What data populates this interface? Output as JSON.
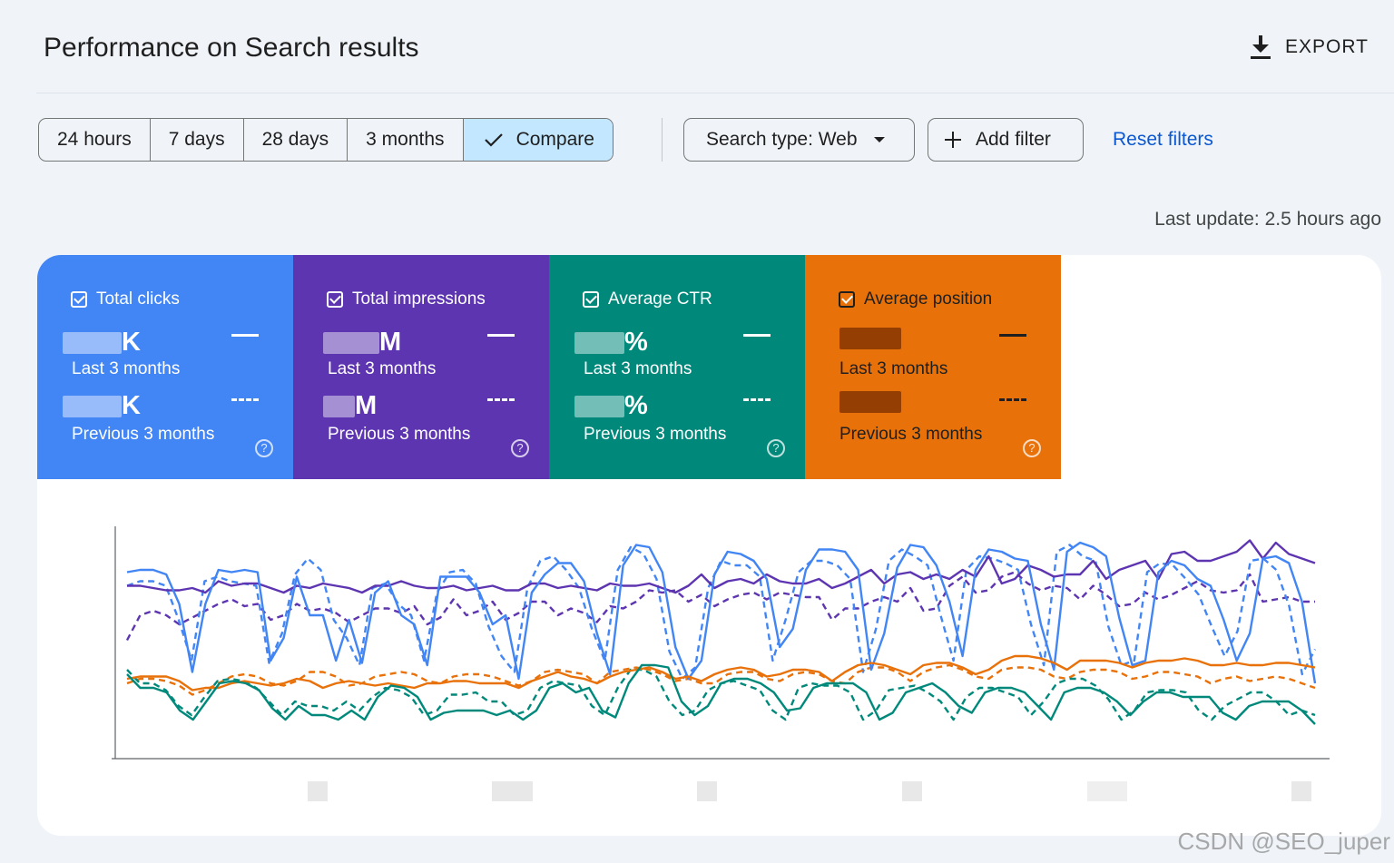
{
  "header": {
    "title": "Performance on Search results",
    "export_label": "EXPORT"
  },
  "toolbar": {
    "ranges": [
      "24 hours",
      "7 days",
      "28 days",
      "3 months"
    ],
    "compare_label": "Compare",
    "search_type_label": "Search type: Web",
    "add_filter_label": "Add filter",
    "reset_label": "Reset filters"
  },
  "last_update": "Last update: 2.5 hours ago",
  "metrics": [
    {
      "title": "Total clicks",
      "suffix": "K",
      "current_label": "Last 3 months",
      "previous_label": "Previous 3 months",
      "color": "#4285f4"
    },
    {
      "title": "Total impressions",
      "suffix": "M",
      "current_label": "Last 3 months",
      "previous_label": "Previous 3 months",
      "color": "#5e35b1"
    },
    {
      "title": "Average CTR",
      "suffix": "%",
      "current_label": "Last 3 months",
      "previous_label": "Previous 3 months",
      "color": "#00897b"
    },
    {
      "title": "Average position",
      "suffix": "",
      "current_label": "Last 3 months",
      "previous_label": "Previous 3 months",
      "color": "#e8710a"
    }
  ],
  "watermark": "CSDN @SEO_juper",
  "chart_data": {
    "type": "line",
    "grid": false,
    "x_tick_labels_visible": false,
    "ylim": [
      0,
      100
    ],
    "series": [
      {
        "color": "#5e35b1",
        "dashed": false,
        "values": [
          73,
          73,
          72,
          71,
          71,
          72,
          70,
          75,
          73,
          74,
          74,
          72,
          70,
          73,
          72,
          74,
          73,
          72,
          70,
          73,
          73,
          75,
          73,
          72,
          72,
          73,
          71,
          72,
          73,
          71,
          71,
          74,
          74,
          72,
          73,
          72,
          71,
          74,
          73,
          73,
          74,
          72,
          70,
          73,
          78,
          72,
          75,
          76,
          74,
          78,
          75,
          74,
          74,
          76,
          72,
          74,
          77,
          80,
          74,
          78,
          79,
          76,
          78,
          76,
          80,
          77,
          86,
          74,
          76,
          82,
          80,
          77,
          78,
          78,
          84,
          76,
          80,
          82,
          84,
          76,
          87,
          88,
          84,
          84,
          86,
          88,
          93,
          85,
          92,
          87,
          85,
          83
        ]
      },
      {
        "color": "#5e35b1",
        "dashed": true,
        "values": [
          49,
          60,
          62,
          60,
          56,
          59,
          62,
          65,
          67,
          64,
          65,
          58,
          60,
          65,
          62,
          63,
          61,
          57,
          60,
          63,
          63,
          61,
          64,
          56,
          59,
          67,
          60,
          62,
          66,
          58,
          61,
          66,
          66,
          60,
          63,
          61,
          57,
          64,
          63,
          66,
          71,
          70,
          71,
          66,
          69,
          64,
          67,
          69,
          70,
          67,
          70,
          69,
          68,
          68,
          58,
          63,
          63,
          66,
          68,
          66,
          72,
          62,
          63,
          73,
          77,
          70,
          71,
          77,
          79,
          74,
          71,
          73,
          72,
          67,
          73,
          69,
          64,
          65,
          70,
          67,
          69,
          72,
          75,
          71,
          70,
          71,
          78,
          66,
          67,
          68,
          66,
          66
        ]
      },
      {
        "color": "#4285f4",
        "dashed": false,
        "values": [
          79,
          80,
          80,
          78,
          65,
          35,
          65,
          80,
          79,
          80,
          79,
          40,
          50,
          77,
          60,
          60,
          40,
          58,
          39,
          70,
          75,
          60,
          56,
          38,
          77,
          77,
          77,
          70,
          56,
          60,
          32,
          70,
          78,
          83,
          83,
          75,
          52,
          34,
          82,
          91,
          90,
          79,
          46,
          32,
          40,
          78,
          88,
          87,
          84,
          76,
          46,
          54,
          80,
          89,
          89,
          88,
          80,
          36,
          52,
          81,
          91,
          90,
          82,
          66,
          42,
          80,
          89,
          88,
          85,
          84,
          56,
          36,
          88,
          92,
          90,
          86,
          59,
          38,
          40,
          79,
          84,
          82,
          76,
          73,
          58,
          40,
          52,
          85,
          86,
          83,
          66,
          30
        ]
      },
      {
        "color": "#4285f4",
        "dashed": true,
        "values": [
          73,
          75,
          75,
          73,
          58,
          40,
          75,
          77,
          75,
          74,
          73,
          39,
          52,
          78,
          85,
          80,
          58,
          50,
          38,
          72,
          74,
          65,
          60,
          40,
          70,
          79,
          80,
          74,
          55,
          42,
          35,
          72,
          84,
          86,
          80,
          72,
          54,
          40,
          80,
          90,
          87,
          76,
          44,
          32,
          37,
          72,
          84,
          82,
          82,
          77,
          40,
          58,
          79,
          84,
          84,
          82,
          76,
          35,
          54,
          84,
          89,
          86,
          82,
          60,
          40,
          80,
          86,
          85,
          83,
          80,
          56,
          38,
          88,
          91,
          86,
          84,
          55,
          38,
          40,
          79,
          83,
          82,
          76,
          69,
          55,
          42,
          53,
          84,
          85,
          80,
          64,
          34,
          45
        ]
      },
      {
        "color": "#e8710a",
        "dashed": false,
        "values": [
          32,
          33,
          33,
          33,
          31,
          27,
          28,
          28,
          30,
          31,
          30,
          29,
          30,
          32,
          31,
          28,
          30,
          31,
          30,
          29,
          30,
          29,
          28,
          30,
          30,
          31,
          31,
          30,
          30,
          30,
          28,
          31,
          33,
          35,
          33,
          32,
          30,
          33,
          35,
          36,
          37,
          35,
          32,
          33,
          31,
          34,
          36,
          37,
          36,
          33,
          34,
          36,
          36,
          35,
          31,
          35,
          38,
          39,
          38,
          36,
          34,
          38,
          39,
          39,
          37,
          34,
          36,
          40,
          42,
          42,
          41,
          39,
          36,
          40,
          40,
          40,
          39,
          37,
          39,
          40,
          40,
          41,
          40,
          38,
          38,
          39,
          38,
          38,
          39,
          39,
          38,
          37
        ]
      },
      {
        "color": "#e8710a",
        "dashed": true,
        "values": [
          30,
          32,
          32,
          31,
          29,
          25,
          27,
          30,
          33,
          34,
          33,
          30,
          29,
          31,
          35,
          35,
          33,
          29,
          30,
          33,
          34,
          35,
          34,
          31,
          30,
          33,
          34,
          34,
          33,
          31,
          29,
          31,
          35,
          36,
          35,
          34,
          30,
          35,
          36,
          37,
          36,
          34,
          31,
          32,
          30,
          30,
          34,
          35,
          35,
          32,
          31,
          34,
          35,
          34,
          31,
          30,
          35,
          37,
          37,
          35,
          31,
          35,
          37,
          38,
          36,
          33,
          32,
          36,
          37,
          37,
          36,
          33,
          32,
          35,
          36,
          36,
          35,
          32,
          33,
          35,
          35,
          34,
          33,
          30,
          32,
          33,
          31,
          32,
          33,
          32,
          30,
          28
        ]
      },
      {
        "color": "#00897b",
        "dashed": false,
        "values": [
          34,
          28,
          28,
          26,
          18,
          14,
          22,
          30,
          31,
          30,
          27,
          19,
          14,
          20,
          16,
          16,
          14,
          18,
          14,
          24,
          29,
          28,
          24,
          14,
          17,
          18,
          18,
          18,
          16,
          18,
          14,
          18,
          28,
          30,
          26,
          28,
          18,
          15,
          30,
          38,
          38,
          37,
          22,
          16,
          20,
          30,
          32,
          32,
          30,
          26,
          18,
          19,
          28,
          30,
          30,
          30,
          26,
          14,
          17,
          26,
          28,
          30,
          26,
          20,
          17,
          26,
          28,
          28,
          26,
          20,
          14,
          26,
          28,
          28,
          26,
          22,
          16,
          22,
          26,
          26,
          24,
          24,
          24,
          17,
          14,
          20,
          22,
          22,
          22,
          18,
          12
        ]
      },
      {
        "color": "#00897b",
        "dashed": true,
        "values": [
          36,
          30,
          30,
          27,
          20,
          16,
          24,
          31,
          32,
          31,
          28,
          22,
          16,
          22,
          20,
          20,
          18,
          22,
          18,
          24,
          28,
          27,
          24,
          16,
          18,
          25,
          25,
          26,
          22,
          22,
          16,
          18,
          28,
          31,
          30,
          29,
          20,
          16,
          28,
          36,
          36,
          33,
          22,
          16,
          18,
          27,
          30,
          31,
          29,
          27,
          18,
          14,
          28,
          30,
          29,
          29,
          26,
          14,
          18,
          27,
          28,
          29,
          26,
          22,
          14,
          24,
          28,
          28,
          26,
          24,
          16,
          22,
          30,
          32,
          32,
          29,
          23,
          14,
          18,
          26,
          27,
          27,
          26,
          18,
          14,
          20,
          23,
          26,
          26,
          22,
          16,
          18,
          16
        ]
      }
    ]
  }
}
